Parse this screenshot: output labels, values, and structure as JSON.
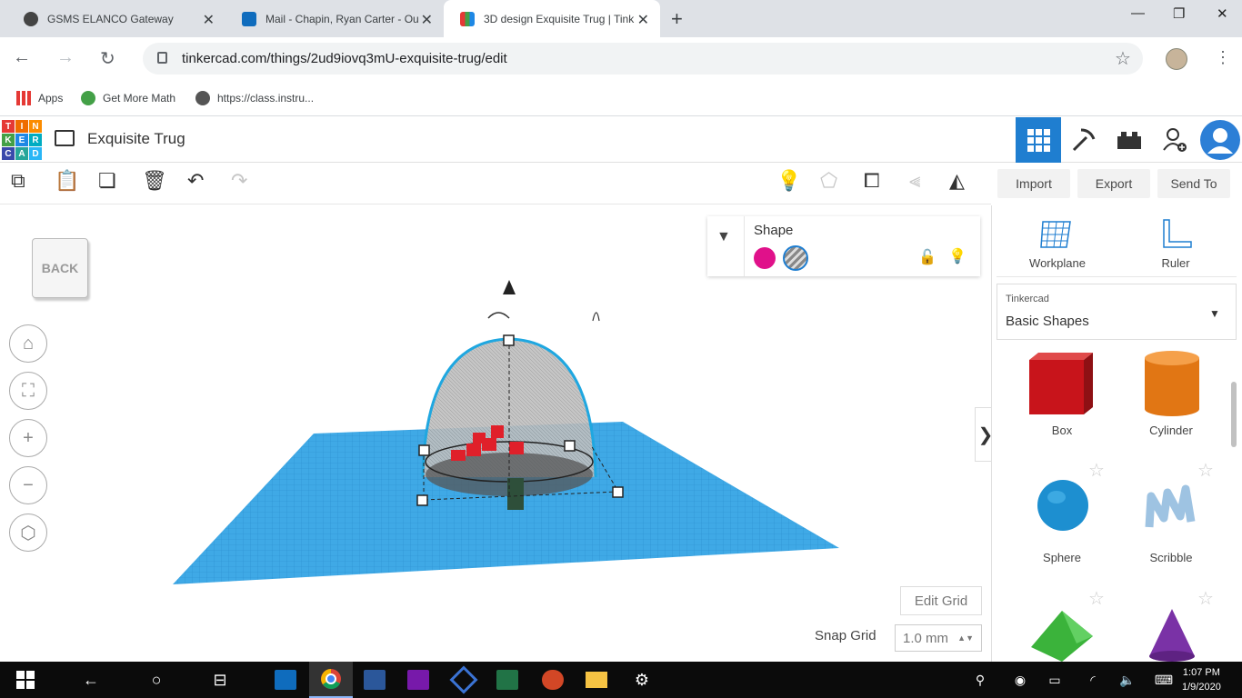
{
  "browser": {
    "tabs": [
      {
        "title": "GSMS ELANCO Gateway",
        "active": false
      },
      {
        "title": "Mail - Chapin, Ryan Carter - Ou",
        "active": false
      },
      {
        "title": "3D design Exquisite Trug | Tink",
        "active": true
      }
    ],
    "url": "tinkercad.com/things/2ud9iovq3mU-exquisite-trug/edit",
    "bookmarks": [
      "Apps",
      "Get More Math",
      "https://class.instru..."
    ]
  },
  "tinkercad": {
    "logo_letters": [
      "T",
      "I",
      "N",
      "K",
      "E",
      "R",
      "C",
      "A",
      "D"
    ],
    "design_title": "Exquisite Trug",
    "toolbar": {
      "import": "Import",
      "export": "Export",
      "send_to": "Send To"
    },
    "viewcube_label": "BACK",
    "shape_panel": {
      "title": "Shape",
      "solid_color": "#e0118a"
    },
    "edit_grid": "Edit Grid",
    "snap_grid_label": "Snap Grid",
    "snap_grid_value": "1.0 mm",
    "right_panel": {
      "workplane": "Workplane",
      "ruler": "Ruler",
      "library_source": "Tinkercad",
      "library_name": "Basic Shapes",
      "shapes": [
        "Box",
        "Cylinder",
        "Sphere",
        "Scribble"
      ]
    }
  },
  "taskbar": {
    "time": "1:07 PM",
    "date": "1/9/2020"
  }
}
